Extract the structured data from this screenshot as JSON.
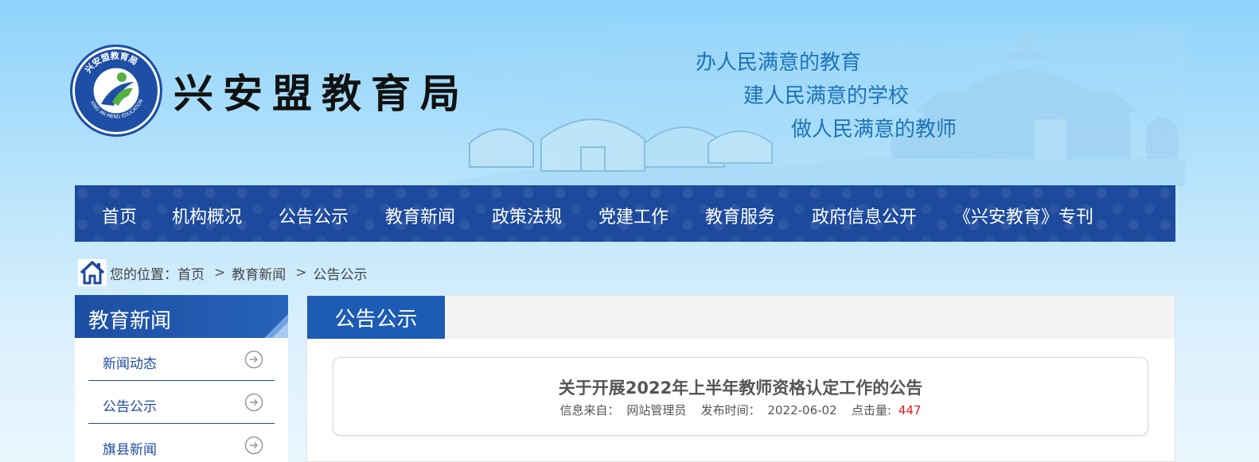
{
  "header": {
    "site_title": "兴安盟教育局",
    "logo_ring_text": "兴安盟教育局",
    "logo_en_text": "XING AN MENG EDUCATION",
    "slogans": [
      "办人民满意的教育",
      "建人民满意的学校",
      "做人民满意的教师"
    ]
  },
  "nav": {
    "items": [
      "首页",
      "机构概况",
      "公告公示",
      "教育新闻",
      "政策法规",
      "党建工作",
      "教育服务",
      "政府信息公开",
      "《兴安教育》专刊"
    ]
  },
  "breadcrumb": {
    "prefix": "您的位置：",
    "items": [
      "首页",
      "教育新闻",
      "公告公示"
    ],
    "separator": ">"
  },
  "sidebar": {
    "title": "教育新闻",
    "items": [
      "新闻动态",
      "公告公示",
      "旗县新闻"
    ]
  },
  "main": {
    "tab_title": "公告公示",
    "article": {
      "title": "关于开展2022年上半年教师资格认定工作的公告",
      "source_label": "信息来自：",
      "source": "网站管理员",
      "date_label": "发布时间：",
      "date": "2022-06-02",
      "views_label": "点击量:",
      "views": "447"
    }
  },
  "colors": {
    "nav_bg": "#1d4a9c",
    "accent": "#1d5cb5",
    "slogan": "#1d74b8",
    "views": "#e21b1b"
  }
}
